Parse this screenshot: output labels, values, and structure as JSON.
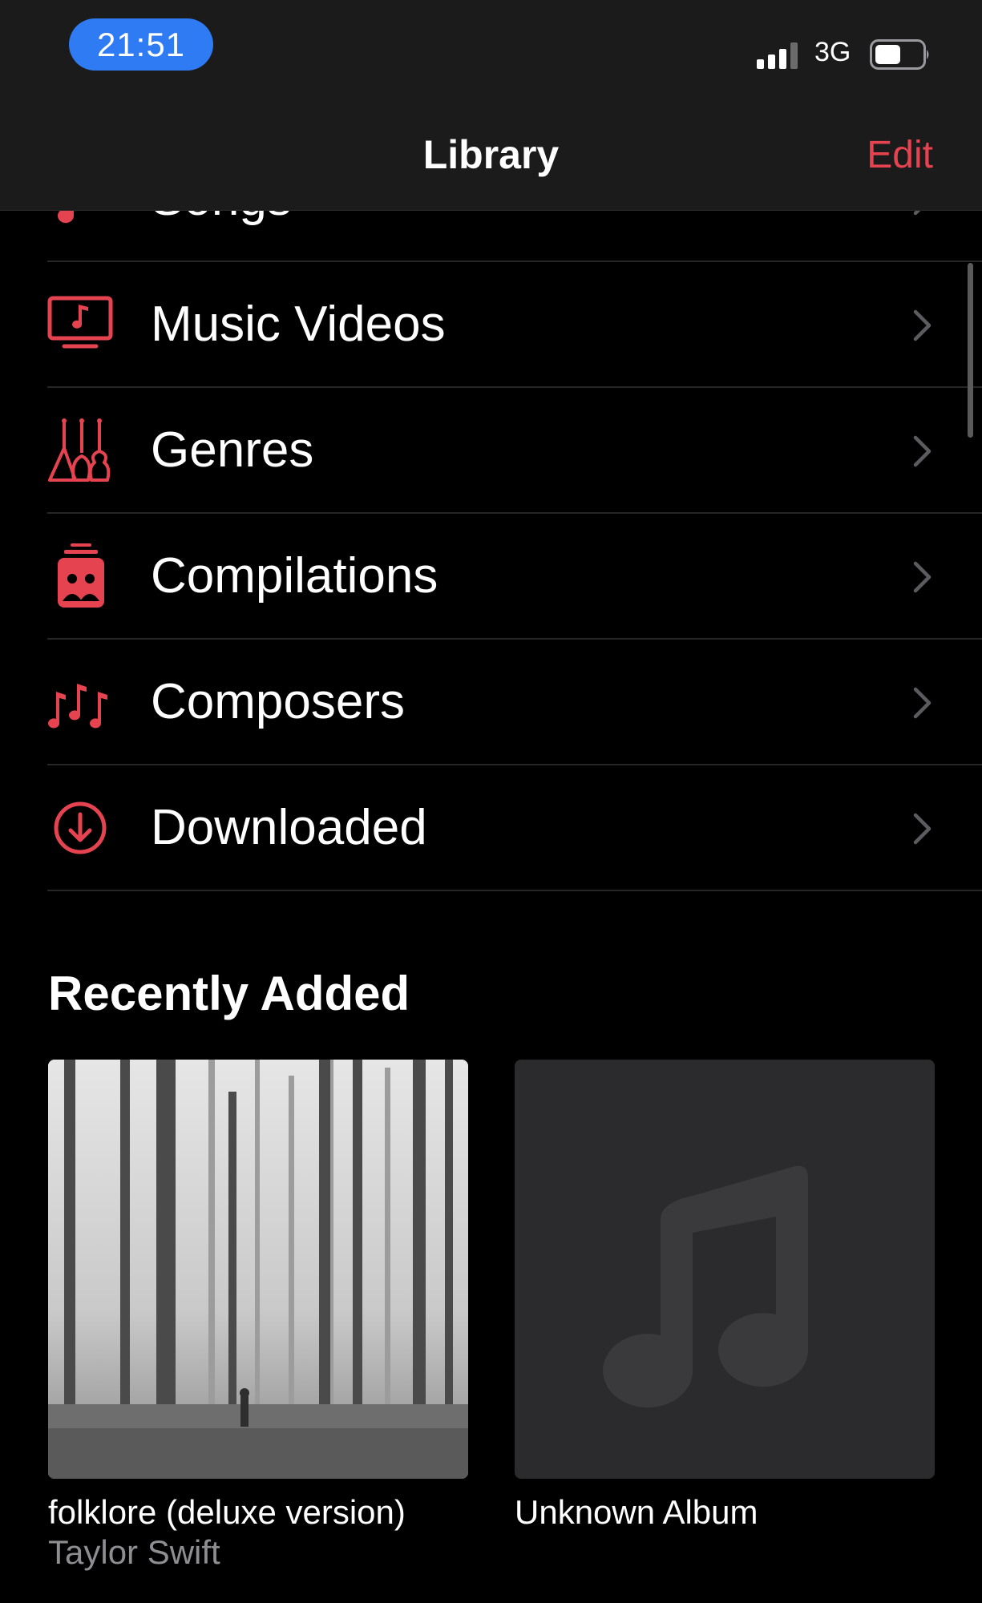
{
  "status_bar": {
    "time": "21:51",
    "network": "3G"
  },
  "nav": {
    "title": "Library",
    "edit_label": "Edit"
  },
  "library_items": [
    {
      "label": "Songs",
      "icon": "music-note-icon"
    },
    {
      "label": "Music Videos",
      "icon": "music-video-icon"
    },
    {
      "label": "Genres",
      "icon": "guitars-icon"
    },
    {
      "label": "Compilations",
      "icon": "compilation-icon"
    },
    {
      "label": "Composers",
      "icon": "composers-icon"
    },
    {
      "label": "Downloaded",
      "icon": "download-circle-icon"
    }
  ],
  "recently_added": {
    "title": "Recently Added",
    "albums": [
      {
        "name": "folklore (deluxe version)",
        "artist": "Taylor Swift",
        "art": "forest-cover"
      },
      {
        "name": "Unknown Album",
        "artist": "",
        "art": "music-note-placeholder"
      }
    ]
  },
  "colors": {
    "accent": "#e5434f",
    "status_pill": "#2f7bf4",
    "background": "#000000",
    "nav_background": "#1b1b1c"
  }
}
